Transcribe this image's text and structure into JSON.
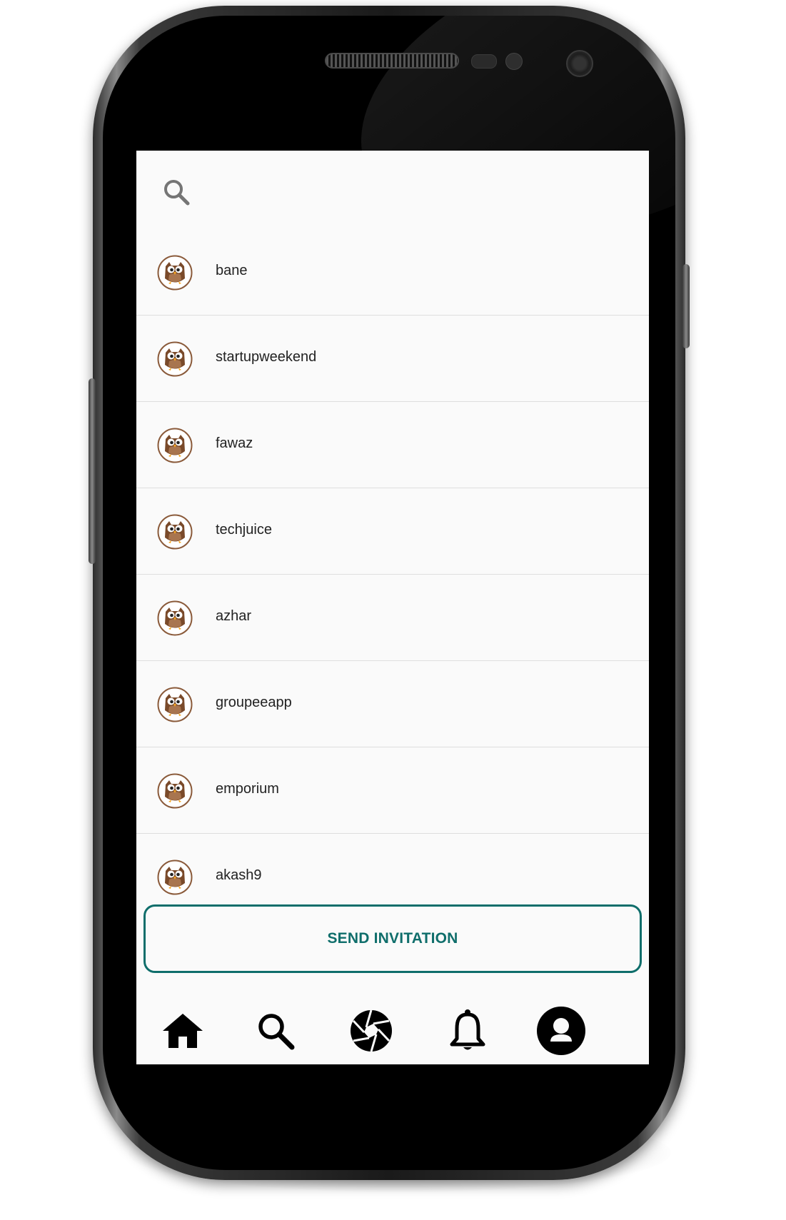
{
  "search": {
    "placeholder": ""
  },
  "contacts": [
    {
      "username": "bane"
    },
    {
      "username": "startupweekend"
    },
    {
      "username": "fawaz"
    },
    {
      "username": "techjuice"
    },
    {
      "username": "azhar"
    },
    {
      "username": "groupeeapp"
    },
    {
      "username": "emporium"
    },
    {
      "username": "akash9"
    }
  ],
  "actions": {
    "send_invitation_label": "SEND INVITATION"
  },
  "bottom_nav": [
    {
      "icon": "home-icon"
    },
    {
      "icon": "search-icon"
    },
    {
      "icon": "camera-shutter-icon"
    },
    {
      "icon": "bell-icon"
    },
    {
      "icon": "profile-icon",
      "active": true
    }
  ],
  "colors": {
    "accent": "#0f6e6b",
    "screen_bg": "#fafafa",
    "divider": "#dedede",
    "avatar_brown": "#7a4a2a"
  }
}
